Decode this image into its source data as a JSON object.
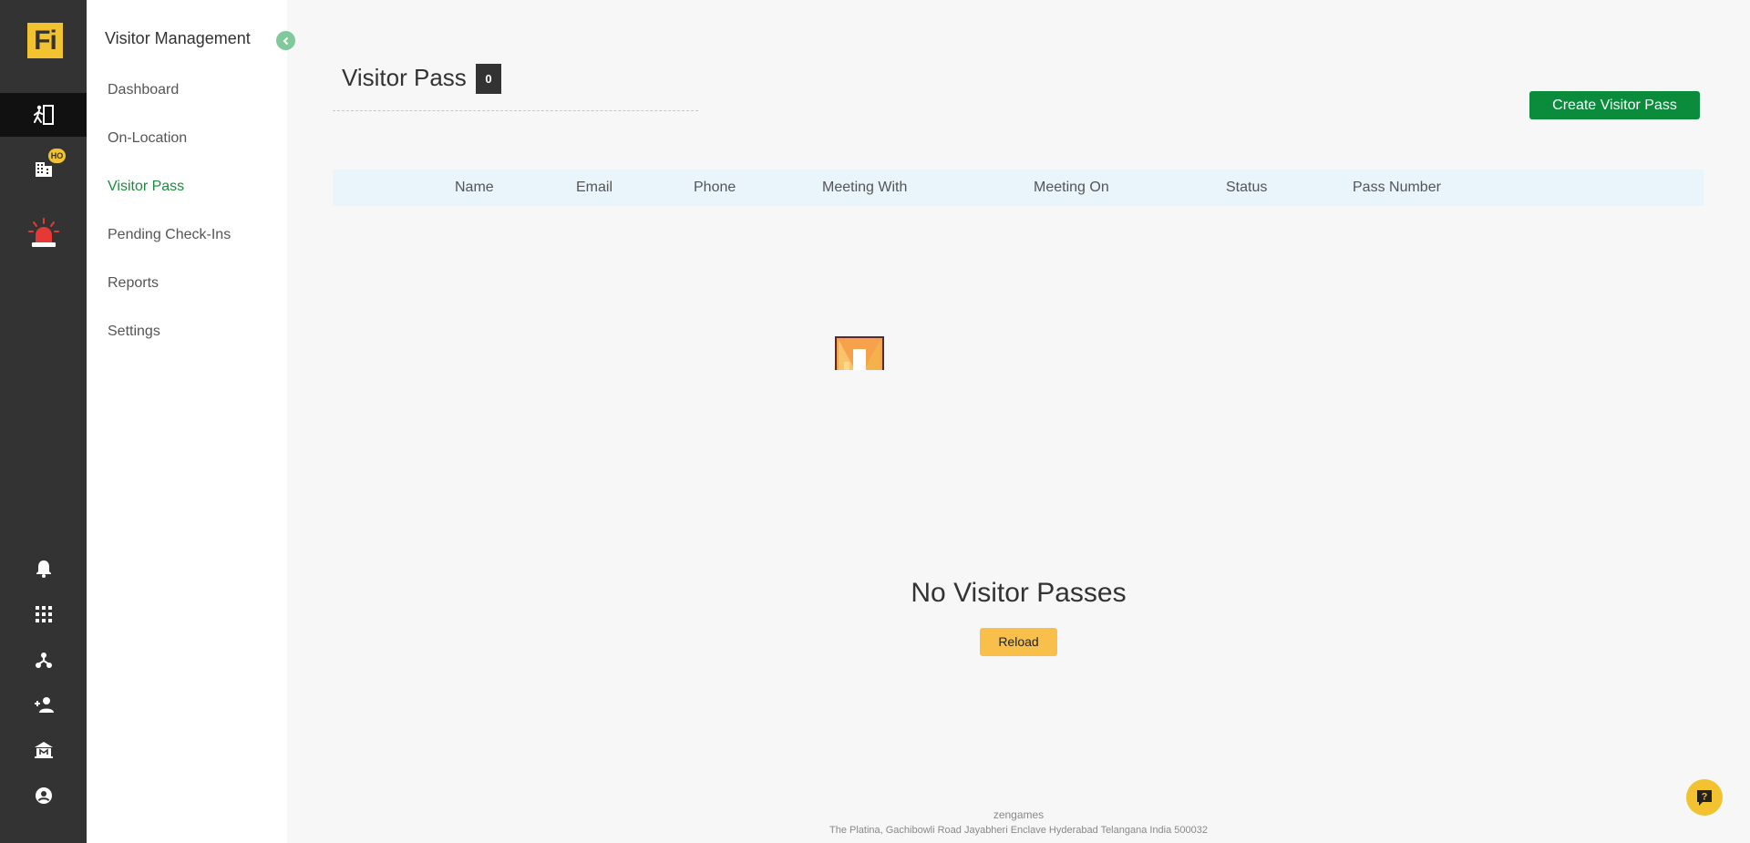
{
  "app": {
    "logo_text": "Fi",
    "ho_badge": "HO"
  },
  "rail": {
    "items": [
      {
        "icon": "visitor-icon",
        "active": true
      },
      {
        "icon": "building-icon"
      },
      {
        "icon": "emergency-siren-icon"
      },
      {
        "icon": "bell-icon"
      },
      {
        "icon": "apps-grid-icon"
      },
      {
        "icon": "hierarchy-icon"
      },
      {
        "icon": "add-person-icon"
      },
      {
        "icon": "office-icon"
      },
      {
        "icon": "account-circle-icon"
      }
    ]
  },
  "sidebar": {
    "title": "Visitor Management",
    "items": [
      {
        "label": "Dashboard"
      },
      {
        "label": "On-Location"
      },
      {
        "label": "Visitor Pass",
        "active": true
      },
      {
        "label": "Pending Check-Ins"
      },
      {
        "label": "Reports"
      },
      {
        "label": "Settings"
      }
    ]
  },
  "main": {
    "title": "Visitor Pass",
    "count": "0",
    "create_label": "Create Visitor Pass",
    "columns": [
      "Name",
      "Email",
      "Phone",
      "Meeting With",
      "Meeting On",
      "Status",
      "Pass Number"
    ],
    "empty_title": "No Visitor Passes",
    "reload_label": "Reload"
  },
  "footer": {
    "company": "zengames",
    "address": "The Platina, Gachibowli Road Jayabheri Enclave Hyderabad Telangana India 500032"
  },
  "colors": {
    "accent_green": "#0b8c3c",
    "active_nav": "#1e8a3c",
    "brand_yellow": "#f2c230",
    "reload_yellow": "#f8c04a",
    "rail_bg": "#333333",
    "alert_red": "#e53935"
  }
}
